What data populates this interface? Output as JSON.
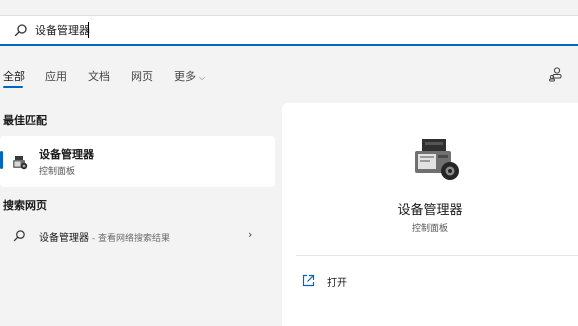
{
  "search": {
    "value": "设备管理器",
    "icon": "search-icon"
  },
  "tabs": {
    "items": [
      {
        "label": "全部",
        "active": true
      },
      {
        "label": "应用"
      },
      {
        "label": "文档"
      },
      {
        "label": "网页"
      },
      {
        "label": "更多"
      }
    ],
    "account_icon": "account-switch-icon"
  },
  "best_match": {
    "header": "最佳匹配",
    "title": "设备管理器",
    "subtitle": "控制面板",
    "icon": "device-manager-icon"
  },
  "web_search": {
    "header": "搜索网页",
    "query": "设备管理器",
    "suffix": " - 查看网络搜索结果",
    "icon": "search-icon",
    "chevron": "chevron-right-icon"
  },
  "detail": {
    "title": "设备管理器",
    "subtitle": "控制面板",
    "icon": "device-manager-icon",
    "action_label": "打开",
    "action_icon": "open-external-icon"
  },
  "colors": {
    "accent": "#0067c0",
    "background": "#f3f3f3",
    "panel": "#ffffff"
  }
}
